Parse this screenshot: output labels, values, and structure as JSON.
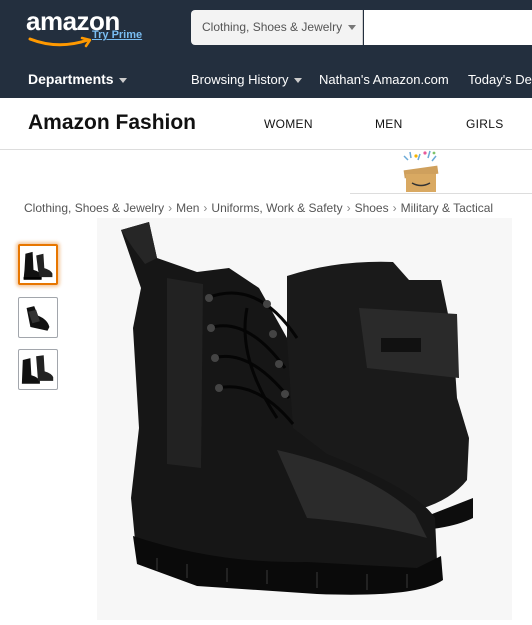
{
  "header": {
    "logo_text": "amazon",
    "logo_prime": "Try Prime",
    "search_category": "Clothing, Shoes & Jewelry",
    "search_placeholder": ""
  },
  "nav": {
    "departments": "Departments",
    "browsing_history": "Browsing History",
    "user_amazon": "Nathan's Amazon.com",
    "todays_deals": "Today's De"
  },
  "fashion": {
    "title": "Amazon Fashion",
    "links": [
      "WOMEN",
      "MEN",
      "GIRLS"
    ]
  },
  "breadcrumb": [
    "Clothing, Shoes & Jewelry",
    "Men",
    "Uniforms, Work & Safety",
    "Shoes",
    "Military & Tactical"
  ],
  "product": {
    "image_icon": "black-tactical-boot-icon",
    "thumbnails": [
      "boots-pair-icon",
      "boot-sole-icon",
      "boots-side-icon"
    ]
  },
  "colors": {
    "header_bg": "#232f3e",
    "accent": "#e77600",
    "prime_blue": "#79bdf2"
  }
}
